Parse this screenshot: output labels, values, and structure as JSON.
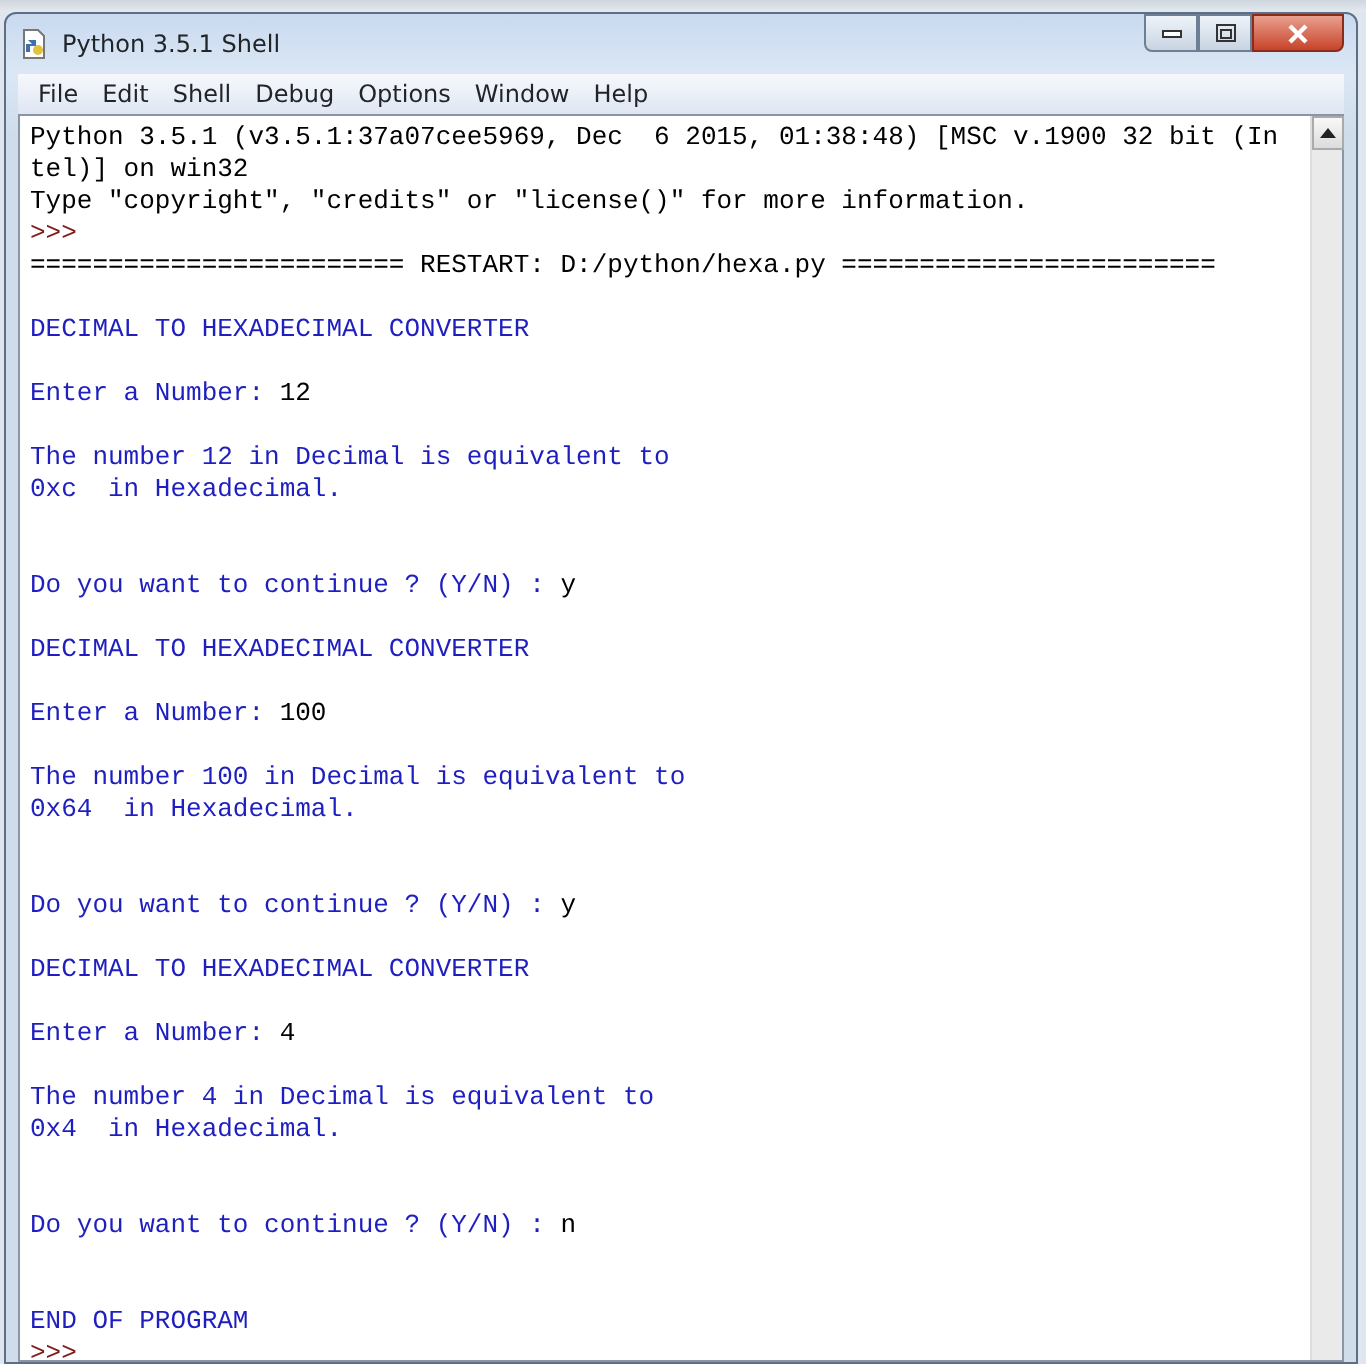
{
  "window": {
    "title": "Python 3.5.1 Shell"
  },
  "menu": [
    "File",
    "Edit",
    "Shell",
    "Debug",
    "Options",
    "Window",
    "Help"
  ],
  "shell_lines": [
    {
      "kind": "stdout",
      "text": "Python 3.5.1 (v3.5.1:37a07cee5969, Dec  6 2015, 01:38:48) [MSC v.1900 32 bit (In"
    },
    {
      "kind": "stdout",
      "text": "tel)] on win32"
    },
    {
      "kind": "stdout",
      "text": "Type \"copyright\", \"credits\" or \"license()\" for more information."
    },
    {
      "kind": "prompt",
      "text": ">>>"
    },
    {
      "kind": "stdout",
      "text": "======================== RESTART: D:/python/hexa.py ========================"
    },
    {
      "kind": "blank"
    },
    {
      "kind": "output",
      "text": "DECIMAL TO HEXADECIMAL CONVERTER"
    },
    {
      "kind": "blank"
    },
    {
      "kind": "output",
      "text": "Enter a Number: ",
      "input": "12"
    },
    {
      "kind": "blank"
    },
    {
      "kind": "output",
      "text": "The number 12 in Decimal is equivalent to"
    },
    {
      "kind": "output",
      "text": "0xc  in Hexadecimal."
    },
    {
      "kind": "blank"
    },
    {
      "kind": "blank"
    },
    {
      "kind": "output",
      "text": "Do you want to continue ? (Y/N) : ",
      "input": "y"
    },
    {
      "kind": "blank"
    },
    {
      "kind": "output",
      "text": "DECIMAL TO HEXADECIMAL CONVERTER"
    },
    {
      "kind": "blank"
    },
    {
      "kind": "output",
      "text": "Enter a Number: ",
      "input": "100"
    },
    {
      "kind": "blank"
    },
    {
      "kind": "output",
      "text": "The number 100 in Decimal is equivalent to"
    },
    {
      "kind": "output",
      "text": "0x64  in Hexadecimal."
    },
    {
      "kind": "blank"
    },
    {
      "kind": "blank"
    },
    {
      "kind": "output",
      "text": "Do you want to continue ? (Y/N) : ",
      "input": "y"
    },
    {
      "kind": "blank"
    },
    {
      "kind": "output",
      "text": "DECIMAL TO HEXADECIMAL CONVERTER"
    },
    {
      "kind": "blank"
    },
    {
      "kind": "output",
      "text": "Enter a Number: ",
      "input": "4"
    },
    {
      "kind": "blank"
    },
    {
      "kind": "output",
      "text": "The number 4 in Decimal is equivalent to"
    },
    {
      "kind": "output",
      "text": "0x4  in Hexadecimal."
    },
    {
      "kind": "blank"
    },
    {
      "kind": "blank"
    },
    {
      "kind": "output",
      "text": "Do you want to continue ? (Y/N) : ",
      "input": "n"
    },
    {
      "kind": "blank"
    },
    {
      "kind": "blank"
    },
    {
      "kind": "output",
      "text": "END OF PROGRAM"
    },
    {
      "kind": "prompt",
      "text": ">>>"
    }
  ]
}
